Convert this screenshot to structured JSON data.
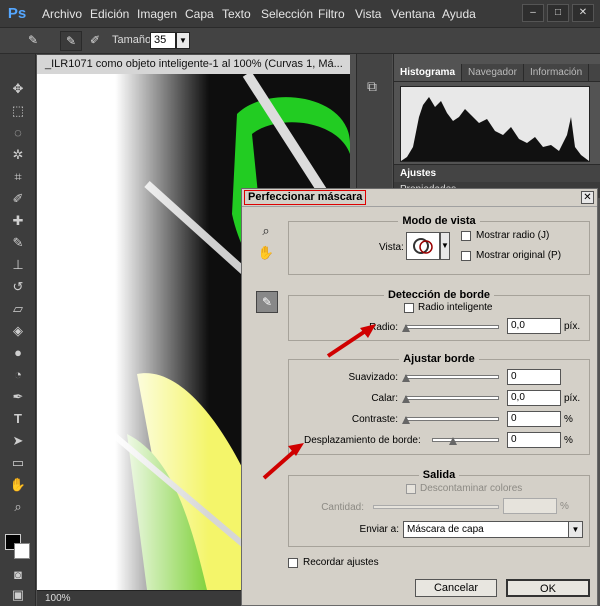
{
  "app": {
    "logo": "Ps"
  },
  "menu": [
    "Archivo",
    "Edición",
    "Imagen",
    "Capa",
    "Texto",
    "Selección",
    "Filtro",
    "Vista",
    "Ventana",
    "Ayuda"
  ],
  "window_buttons": [
    "–",
    "□",
    "✕"
  ],
  "options_bar": {
    "size_label": "Tamaño:",
    "size_value": "35"
  },
  "document": {
    "tab_title": "_ILR1071 como objeto inteligente-1 al 100% (Curvas 1, Má...",
    "zoom": "100%"
  },
  "panels": {
    "tabs": [
      "Histograma",
      "Navegador",
      "Información"
    ],
    "ajustes": "Ajustes",
    "propiedades": "Propiedades"
  },
  "dialog": {
    "title": "Perfeccionar máscara",
    "modo_vista": {
      "title": "Modo de vista",
      "vista_label": "Vista:",
      "mostrar_radio": "Mostrar radio (J)",
      "mostrar_original": "Mostrar original (P)"
    },
    "deteccion": {
      "title": "Detección de borde",
      "radio_inteligente": "Radio inteligente",
      "radio_label": "Radio:",
      "radio_value": "0,0",
      "radio_unit": "píx."
    },
    "ajustar": {
      "title": "Ajustar borde",
      "suavizado_label": "Suavizado:",
      "suavizado_value": "0",
      "calar_label": "Calar:",
      "calar_value": "0,0",
      "calar_unit": "píx.",
      "contraste_label": "Contraste:",
      "contraste_value": "0",
      "contraste_unit": "%",
      "desplazamiento_label": "Desplazamiento de borde:",
      "desplazamiento_value": "0",
      "desplazamiento_unit": "%"
    },
    "salida": {
      "title": "Salida",
      "descontaminar": "Descontaminar colores",
      "cantidad_label": "Cantidad:",
      "cantidad_unit": "%",
      "enviar_label": "Enviar a:",
      "enviar_value": "Máscara de capa"
    },
    "recordar": "Recordar ajustes",
    "cancel": "Cancelar",
    "ok": "OK"
  },
  "colors": {
    "highlight_red": "#d00000",
    "dialog_bg": "#d4d0c8",
    "ps_blue": "#55a7ff"
  }
}
